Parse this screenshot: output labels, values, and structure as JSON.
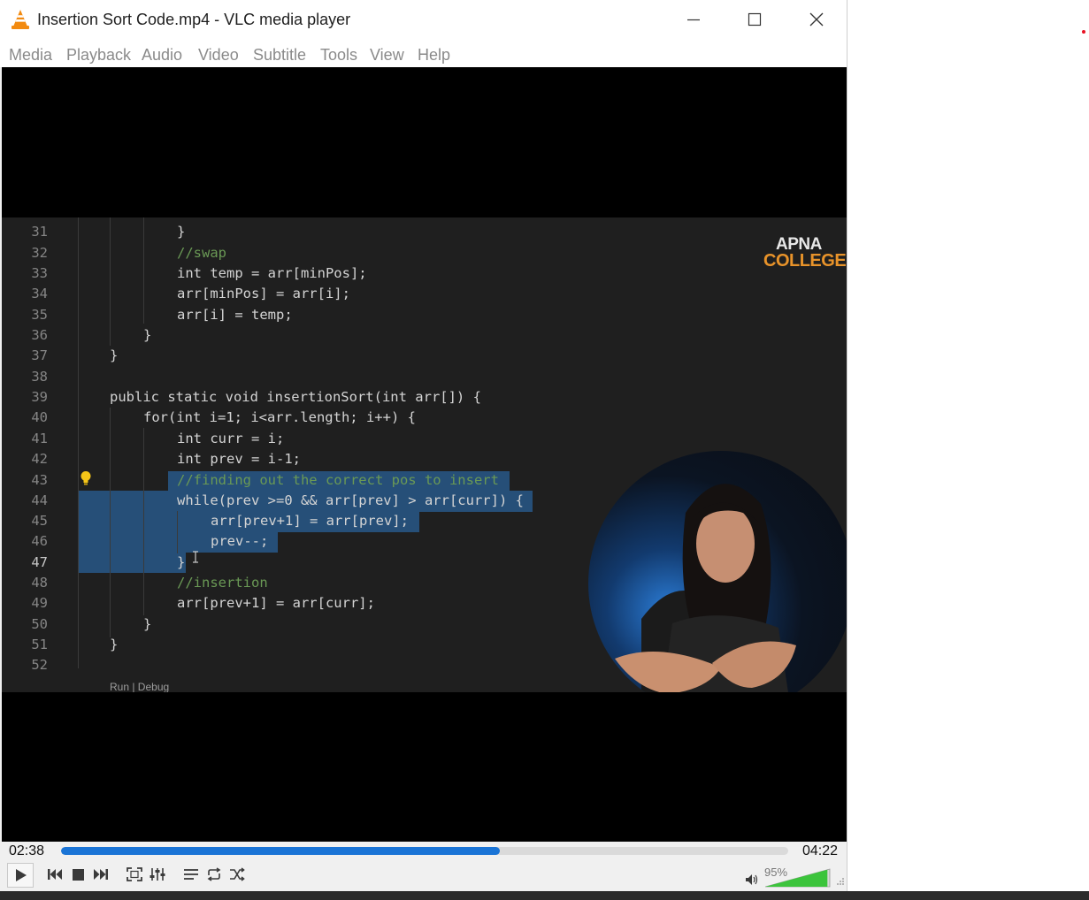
{
  "window": {
    "title": "Insertion Sort Code.mp4 - VLC media player"
  },
  "menu": [
    "Media",
    "Playback",
    "Audio",
    "Video",
    "Subtitle",
    "Tools",
    "View",
    "Help"
  ],
  "video": {
    "logo_line1": "APNA",
    "logo_line2": "COLLEGE",
    "codelens": "Run | Debug",
    "code_lines": [
      {
        "n": "31",
        "text": "}"
      },
      {
        "n": "32",
        "text": "//swap"
      },
      {
        "n": "33",
        "text": "int temp = arr[minPos];"
      },
      {
        "n": "34",
        "text": "arr[minPos] = arr[i];"
      },
      {
        "n": "35",
        "text": "arr[i] = temp;"
      },
      {
        "n": "36",
        "text": "}"
      },
      {
        "n": "37",
        "text": "}"
      },
      {
        "n": "38",
        "text": ""
      },
      {
        "n": "39",
        "text": "public static void insertionSort(int arr[]) {"
      },
      {
        "n": "40",
        "text": "for(int i=1; i<arr.length; i++) {"
      },
      {
        "n": "41",
        "text": "int curr = i;"
      },
      {
        "n": "42",
        "text": "int prev = i-1;"
      },
      {
        "n": "43",
        "text": "//finding out the correct pos to insert"
      },
      {
        "n": "44",
        "text": "while(prev >=0 && arr[prev] > arr[curr]) {"
      },
      {
        "n": "45",
        "text": "arr[prev+1] = arr[prev];"
      },
      {
        "n": "46",
        "text": "prev--;"
      },
      {
        "n": "47",
        "text": "}"
      },
      {
        "n": "48",
        "text": "//insertion"
      },
      {
        "n": "49",
        "text": "arr[prev+1] = arr[curr];"
      },
      {
        "n": "50",
        "text": "}"
      },
      {
        "n": "51",
        "text": "}"
      },
      {
        "n": "52",
        "text": ""
      }
    ]
  },
  "player": {
    "elapsed": "02:38",
    "total": "04:22",
    "progress_fraction": 0.603,
    "volume": "95%",
    "volume_fraction": 0.95
  },
  "icons": [
    "vlc-cone-icon",
    "minimize-icon",
    "maximize-icon",
    "close-icon",
    "play-icon",
    "previous-icon",
    "stop-icon",
    "next-icon",
    "fullscreen-icon",
    "extended-settings-icon",
    "playlist-icon",
    "loop-icon",
    "shuffle-icon",
    "speaker-icon",
    "lightbulb-icon"
  ],
  "colors": {
    "progress": "#1a74d6",
    "volume": "#3cc43c",
    "selection": "#264f78",
    "code_bg": "#1f1f1f"
  }
}
